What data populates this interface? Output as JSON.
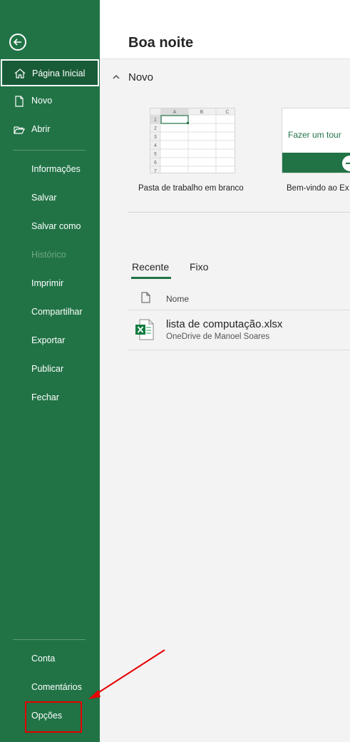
{
  "sidebar": {
    "items": [
      {
        "label": "Página Inicial"
      },
      {
        "label": "Novo"
      },
      {
        "label": "Abrir"
      },
      {
        "label": "Informações"
      },
      {
        "label": "Salvar"
      },
      {
        "label": "Salvar como"
      },
      {
        "label": "Histórico"
      },
      {
        "label": "Imprimir"
      },
      {
        "label": "Compartilhar"
      },
      {
        "label": "Exportar"
      },
      {
        "label": "Publicar"
      },
      {
        "label": "Fechar"
      }
    ],
    "bottom": [
      {
        "label": "Conta"
      },
      {
        "label": "Comentários"
      },
      {
        "label": "Opções"
      }
    ]
  },
  "main": {
    "greeting": "Boa noite",
    "new_section": "Novo",
    "templates": [
      {
        "label": "Pasta de trabalho em branco"
      },
      {
        "label": "Bem-vindo ao Ex",
        "preview_text": "Fazer um tour"
      }
    ],
    "grid": {
      "cols": [
        "A",
        "B",
        "C"
      ],
      "rows": [
        "1",
        "2",
        "3",
        "4",
        "5",
        "6",
        "7"
      ]
    },
    "tabs": [
      {
        "label": "Recente"
      },
      {
        "label": "Fixo"
      }
    ],
    "list_header": "Nome",
    "files": [
      {
        "name": "lista de computação.xlsx",
        "location": "OneDrive de Manoel Soares"
      }
    ]
  },
  "colors": {
    "brand": "#217346",
    "highlight": "#e60000"
  }
}
